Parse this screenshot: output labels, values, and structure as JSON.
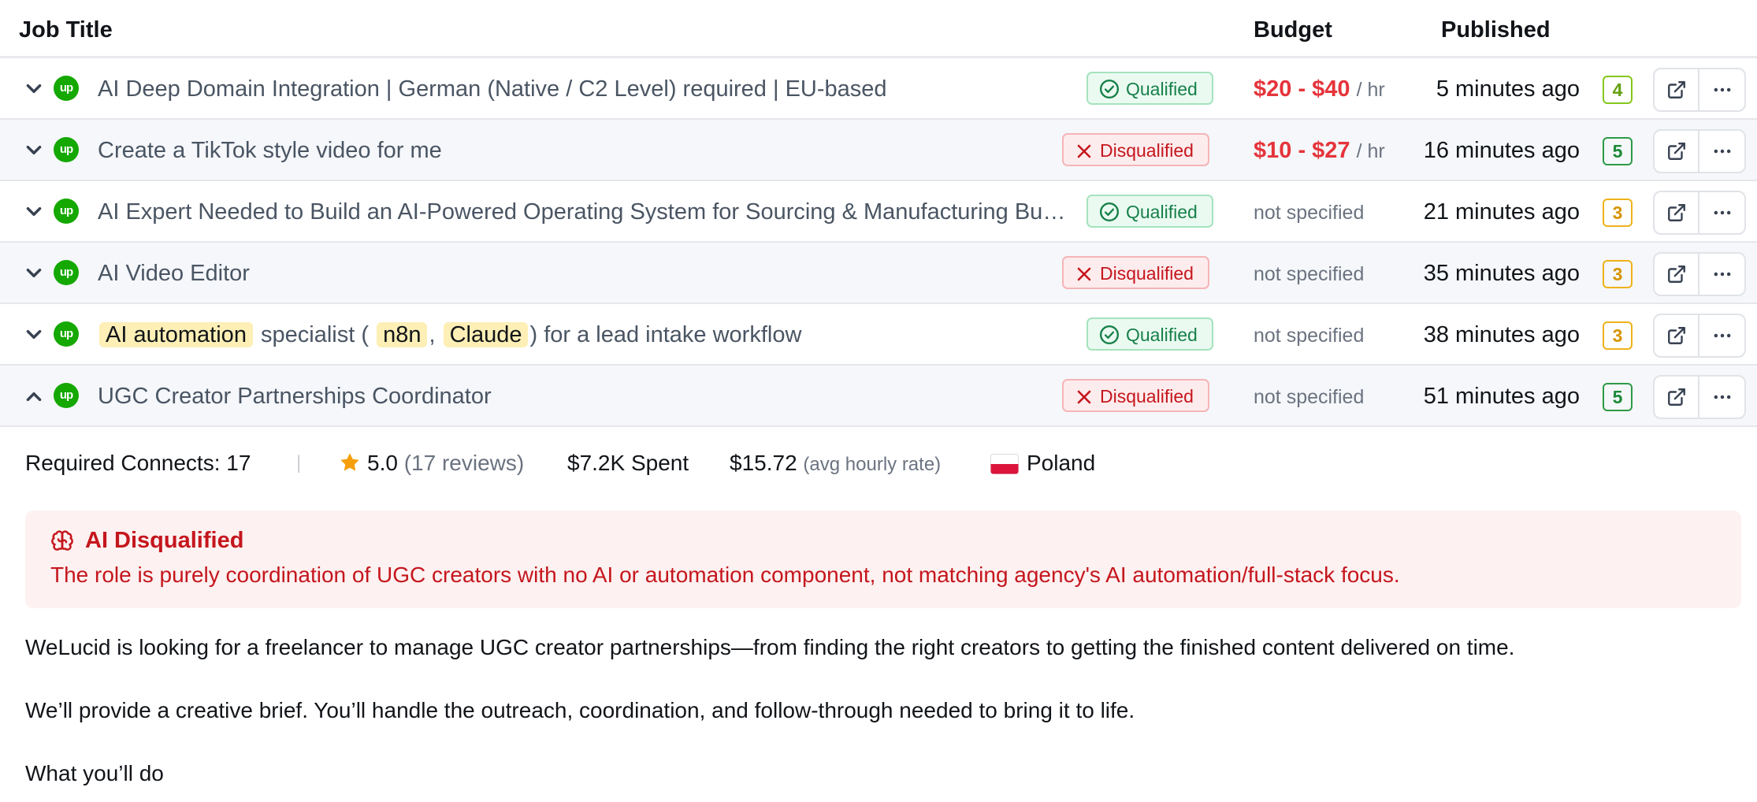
{
  "columns": {
    "job_title": "Job Title",
    "budget": "Budget",
    "published": "Published"
  },
  "jobs": [
    {
      "expanded": false,
      "title_segments": [
        {
          "text": "AI Deep Domain Integration | German (Native / C2 Level) required | EU-based",
          "highlight": false
        }
      ],
      "status": "Qualified",
      "budget": {
        "range": "$20 - $40",
        "unit": "/ hr"
      },
      "published": "5 minutes ago",
      "score": "4",
      "score_color": "#63a00d"
    },
    {
      "expanded": false,
      "title_segments": [
        {
          "text": "Create a TikTok style video for me",
          "highlight": false
        }
      ],
      "status": "Disqualified",
      "budget": {
        "range": "$10 - $27",
        "unit": "/ hr"
      },
      "published": "16 minutes ago",
      "score": "5",
      "score_color": "#1c8a38"
    },
    {
      "expanded": false,
      "title_segments": [
        {
          "text": "AI Expert Needed to Build an AI-Powered Operating System for Sourcing & Manufacturing Busi...",
          "highlight": false
        }
      ],
      "status": "Qualified",
      "budget": {
        "text": "not specified"
      },
      "published": "21 minutes ago",
      "score": "3",
      "score_color": "#d69400"
    },
    {
      "expanded": false,
      "title_segments": [
        {
          "text": "AI Video Editor",
          "highlight": false
        }
      ],
      "status": "Disqualified",
      "budget": {
        "text": "not specified"
      },
      "published": "35 minutes ago",
      "score": "3",
      "score_color": "#d69400"
    },
    {
      "expanded": false,
      "title_segments": [
        {
          "text": "AI automation",
          "highlight": true
        },
        {
          "text": " specialist ( ",
          "highlight": false
        },
        {
          "text": "n8n",
          "highlight": true
        },
        {
          "text": ", ",
          "highlight": false
        },
        {
          "text": "Claude",
          "highlight": true
        },
        {
          "text": ") for a lead intake workflow",
          "highlight": false
        }
      ],
      "status": "Qualified",
      "budget": {
        "text": "not specified"
      },
      "published": "38 minutes ago",
      "score": "3",
      "score_color": "#d69400"
    },
    {
      "expanded": true,
      "title_segments": [
        {
          "text": "UGC Creator Partnerships Coordinator",
          "highlight": false
        }
      ],
      "status": "Disqualified",
      "budget": {
        "text": "not specified"
      },
      "published": "51 minutes ago",
      "score": "5",
      "score_color": "#1c8a38"
    }
  ],
  "details": {
    "connects_label": "Required Connects: 17",
    "separator": "|",
    "rating": "5.0",
    "reviews": "(17 reviews)",
    "spent": "$7.2K Spent",
    "avg_rate": "$15.72",
    "avg_rate_label": "(avg hourly rate)",
    "country": "Poland",
    "ai_title": "AI Disqualified",
    "ai_reason": "The role is purely coordination of UGC creators with no AI or automation component, not matching agency's AI automation/full-stack focus.",
    "description": [
      "WeLucid is looking for a freelancer to manage UGC creator partnerships—from finding the right creators to getting the finished content delivered on time.",
      "We’ll provide a creative brief. You’ll handle the outreach, coordination, and follow-through needed to bring it to life.",
      "What you’ll do"
    ]
  },
  "icons": {
    "row_chevron_collapsed": "chevron-down-icon",
    "row_chevron_expanded": "chevron-up-icon",
    "platform": "upwork-logo-icon",
    "qualified": "check-circle-icon",
    "disqualified": "x-icon",
    "open": "external-link-icon",
    "more": "more-horizontal-icon",
    "rating": "star-icon",
    "flag": "poland-flag-icon",
    "ai": "brain-icon"
  },
  "colors": {
    "qualified_text": "#17804a",
    "disqualified_text": "#c5161d",
    "budget_amount": "#e5343b",
    "upwork_green": "#14a800",
    "star": "#f59e0b"
  }
}
